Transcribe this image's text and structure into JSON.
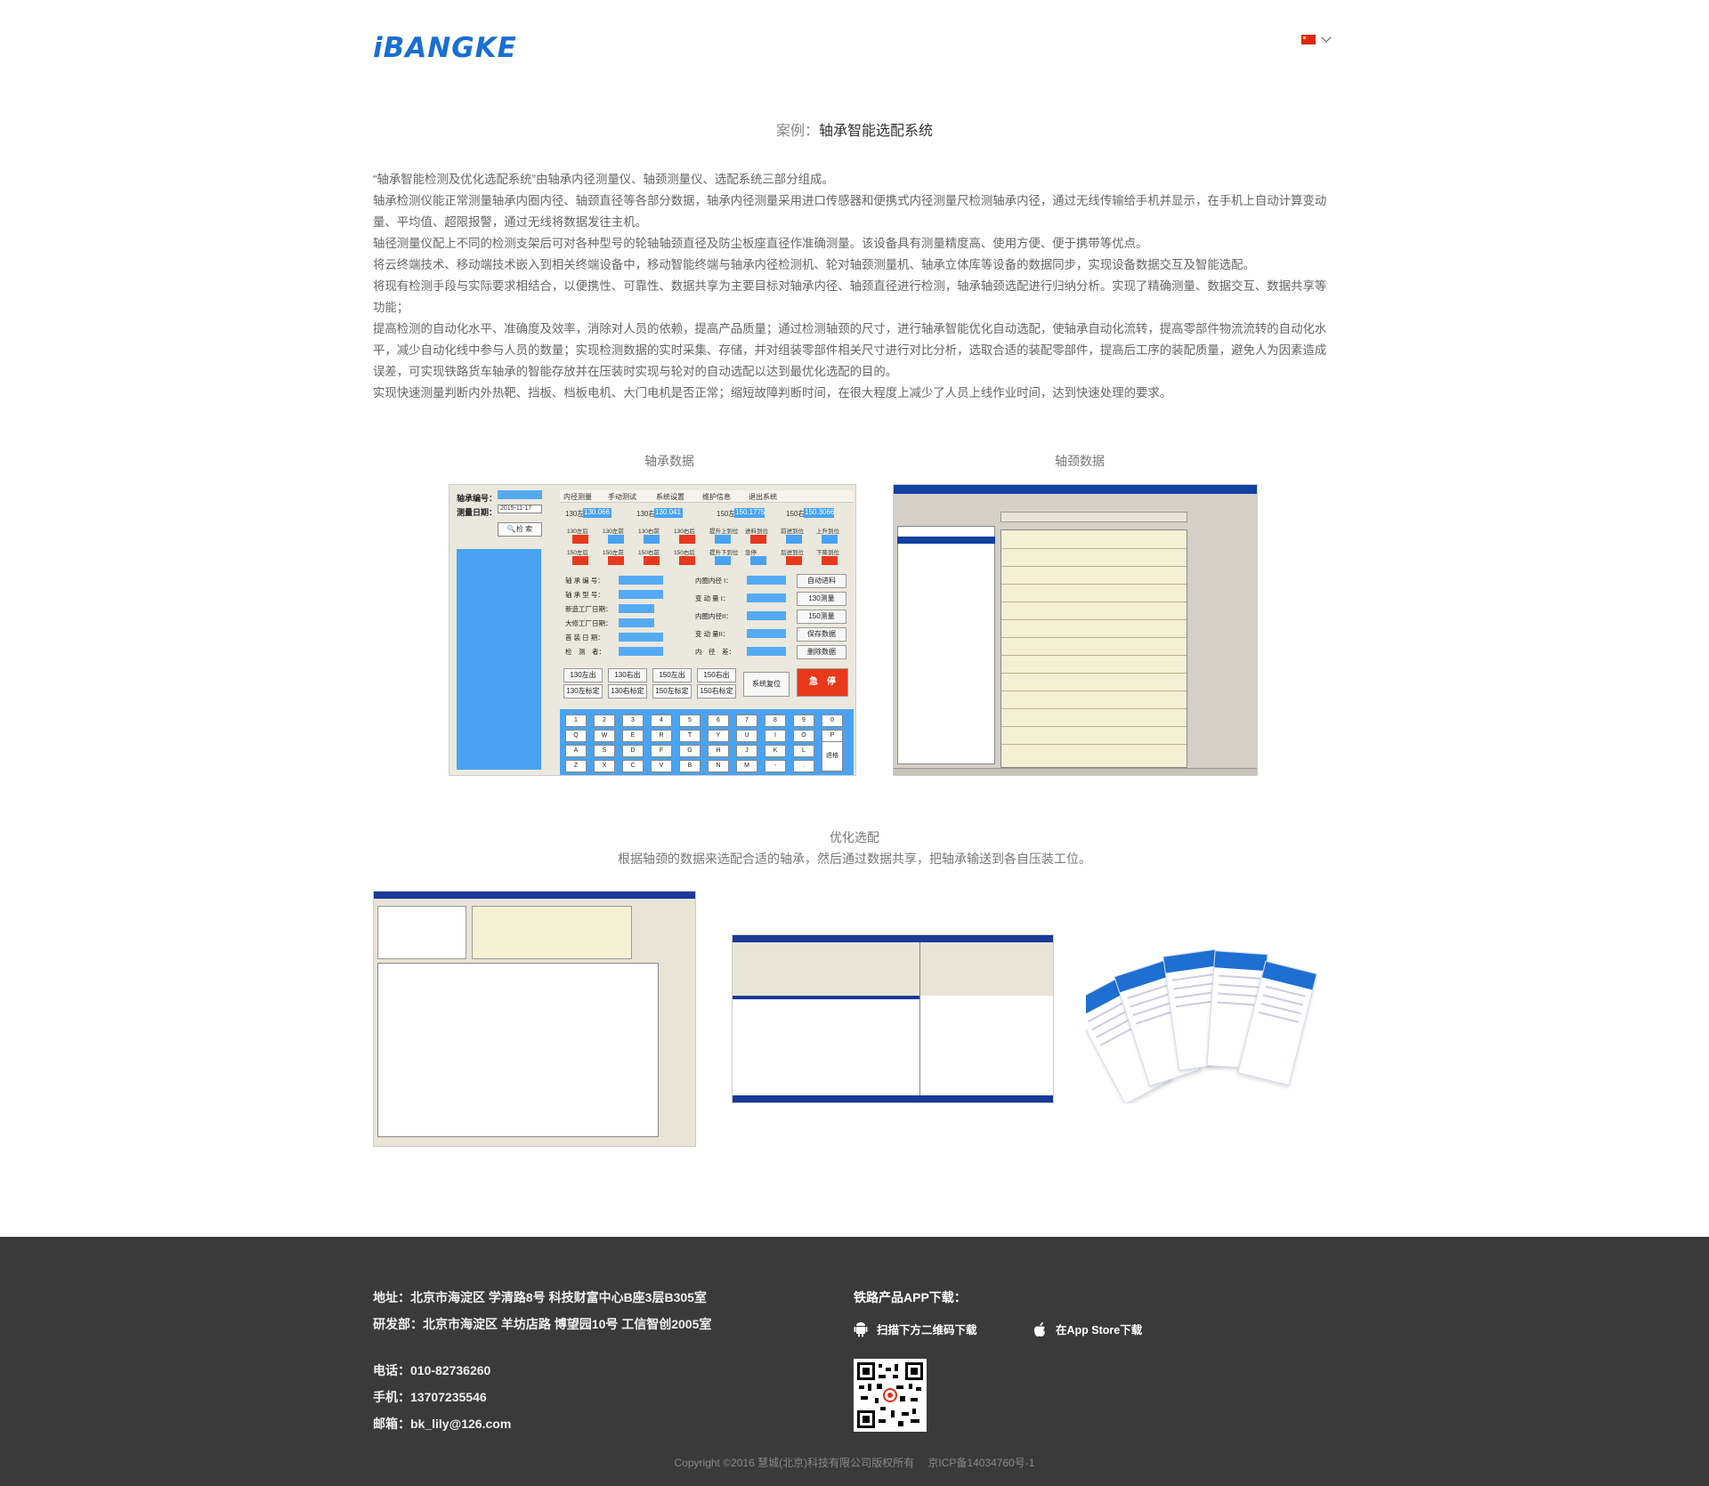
{
  "header": {
    "logo_text": "iBANGKE",
    "language": "中文"
  },
  "page": {
    "title_prefix": "案例：",
    "title": "轴承智能选配系统"
  },
  "description": [
    "“轴承智能检测及优化选配系统”由轴承内径测量仪、轴颈测量仪、选配系统三部分组成。",
    "轴承检测仪能正常测量轴承内圈内径、轴颈直径等各部分数据，轴承内径测量采用进口传感器和便携式内径测量尺检测轴承内径，通过无线传输给手机并显示，在手机上自动计算变动量、平均值、超限报警，通过无线将数据发往主机。",
    "轴径测量仪配上不同的检测支架后可对各种型号的轮轴轴颈直径及防尘板座直径作准确测量。该设备具有测量精度高、使用方便、便于携带等优点。",
    "将云终端技术、移动端技术嵌入到相关终端设备中，移动智能终端与轴承内径检测机、轮对轴颈测量机、轴承立体库等设备的数据同步，实现设备数据交互及智能选配。",
    " 将现有检测手段与实际要求相结合，以便携性、可靠性、数据共享为主要目标对轴承内径、轴颈直径进行检测，轴承轴颈选配进行归纳分析。实现了精确测量、数据交互、数据共享等功能；",
    "提高检测的自动化水平、准确度及效率，消除对人员的依赖，提高产品质量；通过检测轴颈的尺寸，进行轴承智能优化自动选配，使轴承自动化流转，提高零部件物流流转的自动化水平，减少自动化线中参与人员的数量；实现检测数据的实时采集、存储，并对组装零部件相关尺寸进行对比分析，选取合适的装配零部件，提高后工序的装配质量，避免人为因素造成误差，可实现铁路货车轴承的智能存放并在压装时实现与轮对的自动选配以达到最优化选配的目的。",
    "实现快速测量判断内外热靶、挡板、档板电机、大门电机是否正常；缩短故障判断时间，在很大程度上减少了人员上线作业时间，达到快速处理的要求。"
  ],
  "gallery": {
    "caption_left": "轴承数据",
    "caption_right": "轴颈数据",
    "section2_title": "优化选配",
    "section2_sub": "根据轴颈的数据来选配合适的轴承，然后通过数据共享，把轴承输送到各自压装工位。"
  },
  "shot1": {
    "bearing_no_label": "轴承编号：",
    "measure_date_label": "测量日期：",
    "date_value": "2015-11-17",
    "search_btn": "检 索",
    "tabs": [
      "内径测量",
      "手动测试",
      "系统设置",
      "维护信息",
      "退出系统"
    ],
    "readings": [
      "130左",
      "130.066",
      "130右",
      "130.041",
      "150左",
      "150.1775",
      "150右",
      "150.3066"
    ],
    "status_row1": [
      "130左后",
      "130左前",
      "130右前",
      "130右后",
      "提升上到位",
      "进料到位",
      "前进到位",
      "上升到位"
    ],
    "status_row2": [
      "150左后",
      "150左前",
      "150右前",
      "150右后",
      "提升下到位",
      "急停",
      "后进到位",
      "下降到位"
    ],
    "fields": [
      "轴 承 编 号：",
      "轴 承 型 号：",
      "新造工厂日期：",
      "大修工厂日期：",
      "首 装 日 期：",
      "检　测　者："
    ],
    "fields_right": [
      "内圈内径 I：",
      "变 动 量 I：",
      "内圈内径II：",
      "变 动 量II：",
      "内　径　差："
    ],
    "side_buttons": [
      "自动进料",
      "130测量",
      "150测量",
      "保存数据",
      "删除数据"
    ],
    "row_buttons_1": [
      "130左出",
      "130右出",
      "150左出",
      "150右出"
    ],
    "row_buttons_2": [
      "130左标定",
      "130右标定",
      "150左标定",
      "150右标定"
    ],
    "reset_btn": "系统复位",
    "stop_btn": "急　停",
    "keys_row1": [
      "1",
      "2",
      "3",
      "4",
      "5",
      "6",
      "7",
      "8",
      "9",
      "0"
    ],
    "keys_row2": [
      "Q",
      "W",
      "E",
      "R",
      "T",
      "Y",
      "U",
      "I",
      "O",
      "P"
    ],
    "keys_row3": [
      "A",
      "S",
      "D",
      "F",
      "G",
      "H",
      "J",
      "K",
      "L"
    ],
    "keys_row4": [
      "Z",
      "X",
      "C",
      "V",
      "B",
      "N",
      "M",
      "-",
      "."
    ],
    "backspace": "退格"
  },
  "footer": {
    "address": "地址：北京市海淀区 学清路8号 科技财富中心B座3层B305室",
    "rnd": "研发部：北京市海淀区 羊坊店路 博望园10号 工信智创2005室",
    "phone": "电话：010-82736260",
    "mobile": "手机：13707235546",
    "email": "邮箱：bk_lily@126.com",
    "app_title": "铁路产品APP下载：",
    "android_label": "扫描下方二维码下载",
    "ios_label": "在App Store下载",
    "copyright": "Copyright ©2016 慧城(北京)科技有限公司版权所有　 京ICP备14034760号-1"
  },
  "colors": {
    "brand": "#1a6fd0",
    "footer_bg": "#3a3a3a",
    "screen_blue": "#49a3f2",
    "alert_red": "#e8391d"
  }
}
